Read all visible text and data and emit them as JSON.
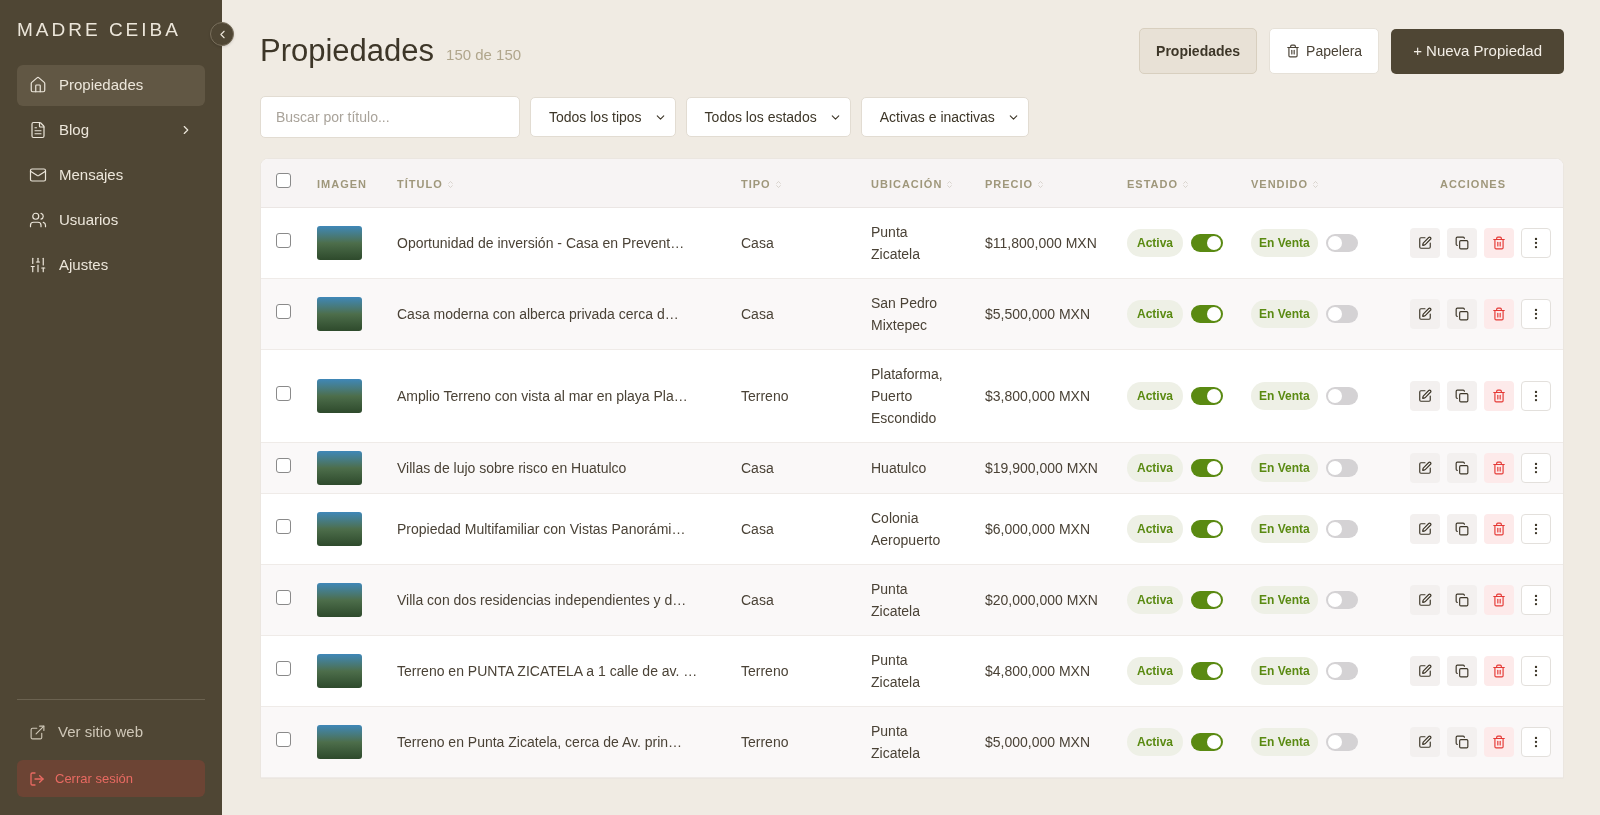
{
  "sidebar": {
    "logo": "MADRE CEIBA",
    "items": [
      {
        "label": "Propiedades",
        "selected": true,
        "has_submenu": false
      },
      {
        "label": "Blog",
        "selected": false,
        "has_submenu": true
      },
      {
        "label": "Mensajes",
        "selected": false,
        "has_submenu": false
      },
      {
        "label": "Usuarios",
        "selected": false,
        "has_submenu": false
      },
      {
        "label": "Ajustes",
        "selected": false,
        "has_submenu": false
      }
    ],
    "footer_link": "Ver sitio web",
    "logout": "Cerrar sesión"
  },
  "header": {
    "title": "Propiedades",
    "count": "150 de 150",
    "tabs": [
      {
        "label": "Propiedades",
        "selected": true
      },
      {
        "label": "Papelera",
        "selected": false
      }
    ],
    "new_button": "+ Nueva Propiedad"
  },
  "filters": {
    "search": {
      "placeholder": "Buscar por título..."
    },
    "selects": [
      "Todos los tipos",
      "Todos los estados",
      "Activas e inactivas"
    ]
  },
  "table": {
    "columns": [
      {
        "label": "IMAGEN",
        "sortable": false
      },
      {
        "label": "TÍTULO",
        "sortable": true
      },
      {
        "label": "TIPO",
        "sortable": true
      },
      {
        "label": "UBICACIÓN",
        "sortable": true
      },
      {
        "label": "PRECIO",
        "sortable": true
      },
      {
        "label": "ESTADO",
        "sortable": true
      },
      {
        "label": "VENDIDO",
        "sortable": true
      },
      {
        "label": "ACCIONES",
        "sortable": false
      }
    ],
    "select_all_checked": false,
    "rows": [
      {
        "checked": false,
        "title": "Oportunidad de inversión - Casa en Prevent…",
        "type": "Casa",
        "location": "Punta Zicatela",
        "price": "$11,800,000 MXN",
        "status": "Activa",
        "active": true,
        "sale": "En Venta",
        "sold": false
      },
      {
        "checked": false,
        "title": "Casa moderna con alberca privada cerca d…",
        "type": "Casa",
        "location": "San Pedro Mixtepec",
        "price": "$5,500,000 MXN",
        "status": "Activa",
        "active": true,
        "sale": "En Venta",
        "sold": false
      },
      {
        "checked": false,
        "title": "Amplio Terreno con vista al mar en playa Pla…",
        "type": "Terreno",
        "location": "Plataforma, Puerto Escondido",
        "price": "$3,800,000 MXN",
        "status": "Activa",
        "active": true,
        "sale": "En Venta",
        "sold": false
      },
      {
        "checked": false,
        "title": "Villas de lujo sobre risco en Huatulco",
        "type": "Casa",
        "location": "Huatulco",
        "price": "$19,900,000 MXN",
        "status": "Activa",
        "active": true,
        "sale": "En Venta",
        "sold": false
      },
      {
        "checked": false,
        "title": "Propiedad Multifamiliar con Vistas Panorámi…",
        "type": "Casa",
        "location": "Colonia Aeropuerto",
        "price": "$6,000,000 MXN",
        "status": "Activa",
        "active": true,
        "sale": "En Venta",
        "sold": false
      },
      {
        "checked": false,
        "title": "Villa con dos residencias independientes y d…",
        "type": "Casa",
        "location": "Punta Zicatela",
        "price": "$20,000,000 MXN",
        "status": "Activa",
        "active": true,
        "sale": "En Venta",
        "sold": false
      },
      {
        "checked": false,
        "title": "Terreno en PUNTA ZICATELA a 1 calle de av. …",
        "type": "Terreno",
        "location": "Punta Zicatela",
        "price": "$4,800,000 MXN",
        "status": "Activa",
        "active": true,
        "sale": "En Venta",
        "sold": false
      },
      {
        "checked": false,
        "title": "Terreno en Punta Zicatela, cerca de Av. prin…",
        "type": "Terreno",
        "location": "Punta Zicatela",
        "price": "$5,000,000 MXN",
        "status": "Activa",
        "active": true,
        "sale": "En Venta",
        "sold": false
      }
    ]
  }
}
